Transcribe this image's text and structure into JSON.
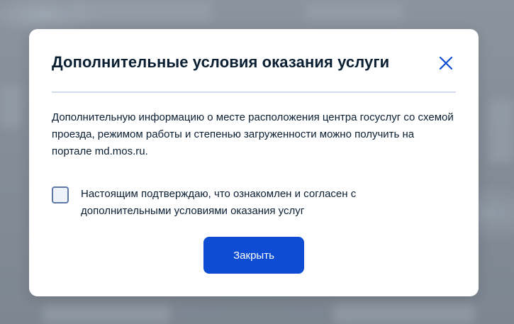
{
  "dialog": {
    "title": "Дополнительные условия оказания услуги",
    "close_icon": "close-icon",
    "info_text": "Дополнительную информацию о месте расположения центра госуслуг со схемой проезда, режимом работы и степенью загруженности можно получить на портале md.mos.ru.",
    "checkbox": {
      "label": "Настоящим подтверждаю, что ознакомлен и согласен с дополнительными условиями оказания услуг",
      "checked": false
    },
    "close_button_label": "Закрыть"
  },
  "colors": {
    "primary": "#0d4cd3",
    "text": "#0b1f33",
    "divider": "#d3dcef",
    "checkbox_border": "#5d78a8"
  }
}
